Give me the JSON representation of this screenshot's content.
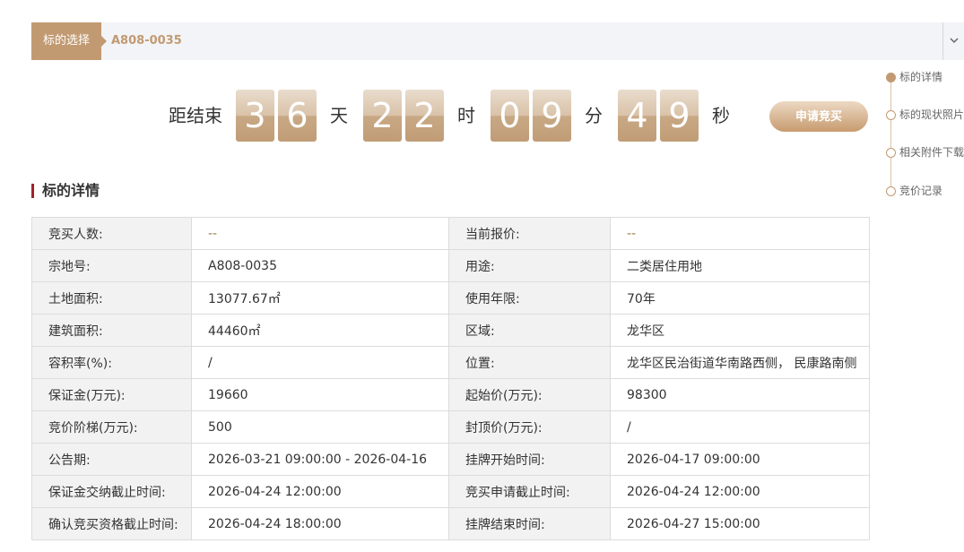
{
  "selector": {
    "tag_label": "标的选择",
    "value": "A808-0035"
  },
  "countdown": {
    "prefix": "距结束",
    "days": [
      "3",
      "6"
    ],
    "days_unit": "天",
    "hours": [
      "2",
      "2"
    ],
    "hours_unit": "时",
    "minutes": [
      "0",
      "9"
    ],
    "minutes_unit": "分",
    "seconds": [
      "4",
      "9"
    ],
    "seconds_unit": "秒"
  },
  "apply_button": "申请竞买",
  "right_nav": {
    "items": [
      {
        "label": "标的详情",
        "active": true
      },
      {
        "label": "标的现状照片",
        "active": false
      },
      {
        "label": "相关附件下载",
        "active": false
      },
      {
        "label": "竞价记录",
        "active": false
      }
    ]
  },
  "section_title": "标的详情",
  "details": {
    "rows": [
      {
        "k1": "竞买人数:",
        "v1": "--",
        "k2": "当前报价:",
        "v2": "--"
      },
      {
        "k1": "宗地号:",
        "v1": "A808-0035",
        "k2": "用途:",
        "v2": "二类居住用地"
      },
      {
        "k1": "土地面积:",
        "v1": "13077.67㎡",
        "k2": "使用年限:",
        "v2": "70年"
      },
      {
        "k1": "建筑面积:",
        "v1": "44460㎡",
        "k2": "区域:",
        "v2": "龙华区"
      },
      {
        "k1": "容积率(%):",
        "v1": "/",
        "k2": "位置:",
        "v2": "龙华区民治街道华南路西侧， 民康路南侧"
      },
      {
        "k1": "保证金(万元):",
        "v1": "19660",
        "k2": "起始价(万元):",
        "v2": "98300"
      },
      {
        "k1": "竞价阶梯(万元):",
        "v1": "500",
        "k2": "封顶价(万元):",
        "v2": "/"
      },
      {
        "k1": "公告期:",
        "v1": "2026-03-21 09:00:00 - 2026-04-16",
        "k2": "挂牌开始时间:",
        "v2": "2026-04-17 09:00:00"
      },
      {
        "k1": "保证金交纳截止时间:",
        "v1": "2026-04-24 12:00:00",
        "k2": "竞买申请截止时间:",
        "v2": "2026-04-24 12:00:00"
      },
      {
        "k1": "确认竞买资格截止时间:",
        "v1": "2026-04-24 18:00:00",
        "k2": "挂牌结束时间:",
        "v2": "2026-04-27 15:00:00"
      }
    ]
  },
  "colors": {
    "accent": "#c29a72",
    "title_bar": "#a0222b"
  }
}
